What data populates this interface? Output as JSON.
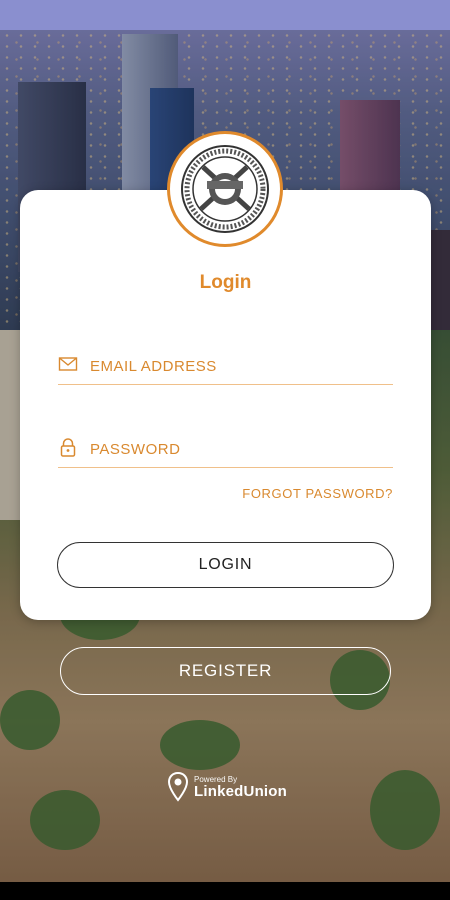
{
  "login": {
    "title": "Login",
    "email": {
      "placeholder": "EMAIL ADDRESS",
      "value": ""
    },
    "password": {
      "placeholder": "PASSWORD",
      "value": ""
    },
    "forgot_label": "FORGOT PASSWORD?",
    "login_label": "LOGIN",
    "register_label": "REGISTER"
  },
  "footer": {
    "powered_by": "Powered By",
    "brand": "LinkedUnion"
  },
  "icons": {
    "email": "envelope-icon",
    "password": "lock-icon",
    "logo": "union-seal-logo",
    "brand": "map-pin-icon"
  },
  "colors": {
    "accent": "#e08a2c",
    "status_bar": "#8a8fcf",
    "card": "#ffffff"
  }
}
